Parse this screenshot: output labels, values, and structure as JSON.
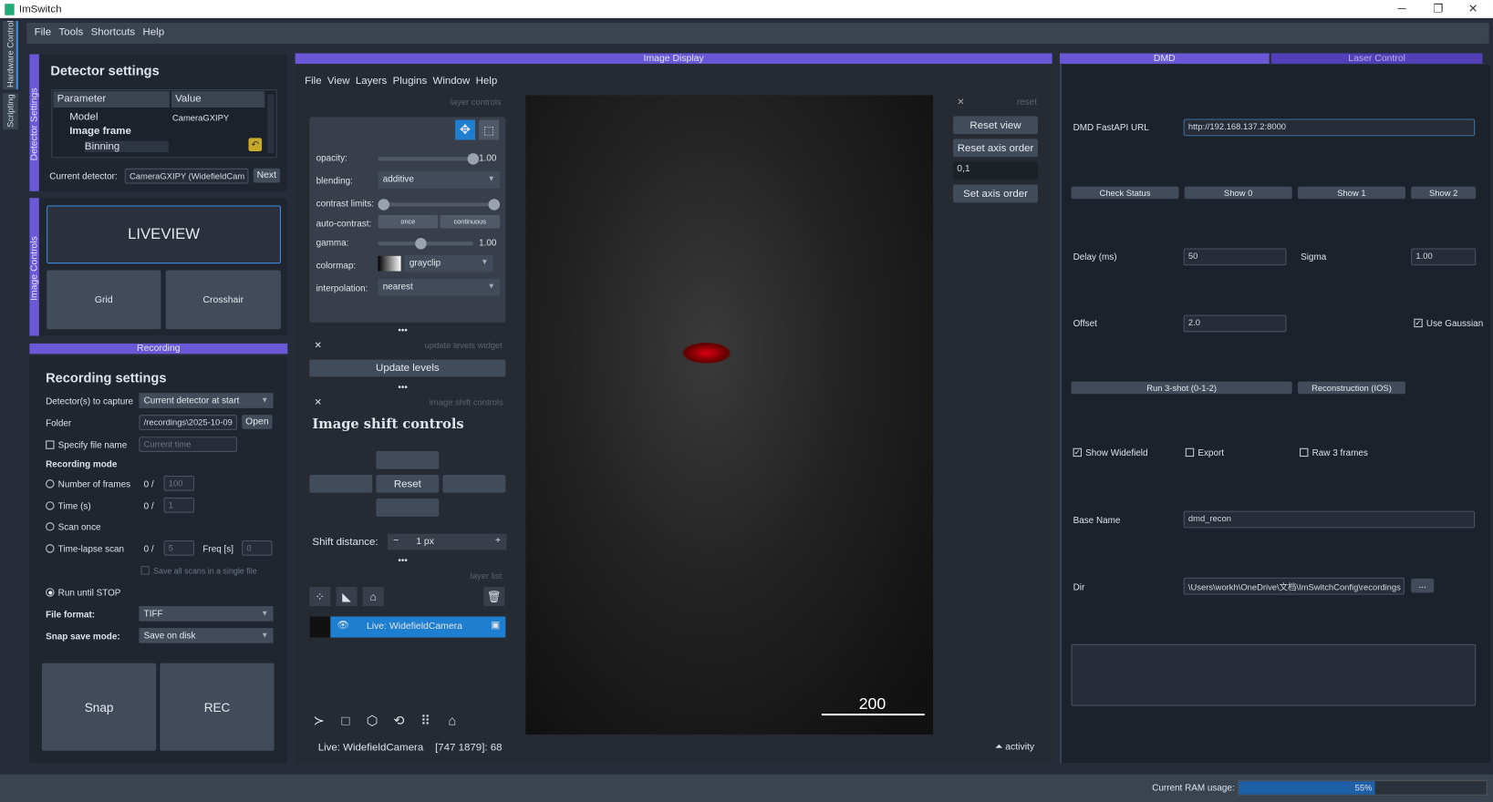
{
  "window": {
    "title": "ImSwitch",
    "min": "─",
    "max": "❐",
    "close": "✕"
  },
  "menu": [
    "File",
    "Tools",
    "Shortcuts",
    "Help"
  ],
  "side_tabs": [
    "Hardware Control",
    "Scripting"
  ],
  "detector": {
    "stripe": "Detector Settings",
    "title": "Detector settings",
    "col_param": "Parameter",
    "col_value": "Value",
    "rows": [
      {
        "p": "Model",
        "v": "CameraGXIPY"
      },
      {
        "p": "Image frame",
        "v": ""
      },
      {
        "p": "Binning",
        "v": ""
      }
    ],
    "current_label": "Current detector:",
    "current_value": "CameraGXIPY (WidefieldCam",
    "next": "Next"
  },
  "image_controls": {
    "stripe": "Image Controls",
    "liveview": "LIVEVIEW",
    "grid": "Grid",
    "crosshair": "Crosshair"
  },
  "recording": {
    "tab": "Recording",
    "title": "Recording settings",
    "detectors_label": "Detector(s) to capture",
    "detectors_value": "Current detector at start",
    "folder_label": "Folder",
    "folder_value": "/recordings\\2025-10-09",
    "open": "Open",
    "specify_label": "Specify file name",
    "specify_placeholder": "Current time",
    "mode_label": "Recording mode",
    "frames_label": "Number of frames",
    "frames_count": "0 /",
    "frames_value": "100",
    "time_label": "Time (s)",
    "time_count": "0 /",
    "time_value": "1",
    "scan_once": "Scan once",
    "timelapse_label": "Time-lapse scan",
    "timelapse_count": "0 /",
    "timelapse_value": "5",
    "freq_label": "Freq [s]",
    "freq_value": "0",
    "save_all": "Save all scans in a single file",
    "run_until": "Run until STOP",
    "format_label": "File format:",
    "format_value": "TIFF",
    "snapmode_label": "Snap save mode:",
    "snapmode_value": "Save on disk",
    "snap": "Snap",
    "rec": "REC"
  },
  "napari": {
    "tab": "Image Display",
    "menu": [
      "File",
      "View",
      "Layers",
      "Plugins",
      "Window",
      "Help"
    ],
    "layer_controls": "layer controls",
    "opacity_label": "opacity:",
    "opacity": 1.0,
    "opacity_text": "1.00",
    "blending_label": "blending:",
    "blending": "additive",
    "contrast_label": "contrast limits:",
    "auto_label": "auto-contrast:",
    "once": "once",
    "continuous": "continuous",
    "gamma_label": "gamma:",
    "gamma_text": "1.00",
    "gamma": 0.45,
    "colormap_label": "colormap:",
    "colormap": "grayclip",
    "interp_label": "interpolation:",
    "interp": "nearest",
    "dots": "•••",
    "update_widget": "update levels widget",
    "update_levels": "Update levels",
    "shift_widget": "image shift controls",
    "shift_title": "Image shift controls",
    "reset": "Reset",
    "shift_label": "Shift distance:",
    "shift_value": "1 px",
    "minus": "−",
    "plus": "+",
    "layer_list": "layer list",
    "layer_name": "Live: WidefieldCamera",
    "reset_small": "reset",
    "reset_view": "Reset view",
    "reset_axis": "Reset axis order",
    "axis_value": "0,1",
    "set_axis": "Set axis order",
    "scale_bar": "200",
    "status_layer": "Live: WidefieldCamera",
    "status_coords": "[747 1879]: 68",
    "activity": "activity"
  },
  "dmd": {
    "tab": "DMD",
    "tab2": "Laser Control",
    "url_label": "DMD FastAPI URL",
    "url": "http://192.168.137.2:8000",
    "check": "Check Status",
    "show0": "Show 0",
    "show1": "Show 1",
    "show2": "Show 2",
    "delay_label": "Delay (ms)",
    "delay": "50",
    "sigma_label": "Sigma",
    "sigma": "1.00",
    "offset_label": "Offset",
    "offset": "2.0",
    "gaussian": "Use Gaussian",
    "run3": "Run 3-shot (0-1-2)",
    "recon": "Reconstruction (IOS)",
    "show_wf": "Show Widefield",
    "export": "Export",
    "raw3": "Raw 3 frames",
    "base_label": "Base Name",
    "base": "dmd_recon",
    "dir_label": "Dir",
    "dir": "\\Users\\workh\\OneDrive\\文档\\ImSwitchConfig\\recordings",
    "browse": "..."
  },
  "status": {
    "ram_label": "Current RAM usage:",
    "ram_text": "55%",
    "ram": 0.55
  },
  "colors": {
    "accent": "#6a58d6",
    "selected": "#1e7fd0",
    "bg": "#1f2630"
  }
}
